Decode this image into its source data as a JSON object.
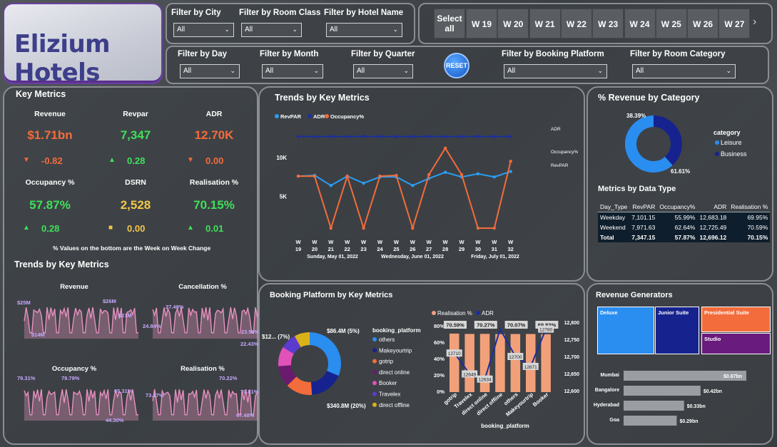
{
  "brand": "Elizium Hotels",
  "filters_top": [
    {
      "label": "Filter by City",
      "value": "All"
    },
    {
      "label": "Filter by Room Class",
      "value": "All"
    },
    {
      "label": "Filter by Hotel Name",
      "value": "All"
    }
  ],
  "filters_bottom": [
    {
      "label": "Filter by Day",
      "value": "All"
    },
    {
      "label": "Filter by Month",
      "value": "All"
    },
    {
      "label": "Filter by Quarter",
      "value": "All"
    },
    {
      "label": "Filter by Booking Platform",
      "value": "All"
    },
    {
      "label": "Filter by Room Category",
      "value": "All"
    }
  ],
  "reset_label": "RESET",
  "week_buttons": {
    "select_all": "Select all",
    "weeks": [
      "W 19",
      "W 20",
      "W 21",
      "W 22",
      "W 23",
      "W 24",
      "W 25",
      "W 26",
      "W 27"
    ]
  },
  "key_metrics": {
    "title": "Key Metrics",
    "items": [
      {
        "label": "Revenue",
        "value": "$1.71bn",
        "change": "-0.82",
        "dir": "down",
        "color": "#f36c3b",
        "chg_color": "#f36c3b"
      },
      {
        "label": "Revpar",
        "value": "7,347",
        "change": "0.28",
        "dir": "up",
        "color": "#3fe05a",
        "chg_color": "#3fe05a"
      },
      {
        "label": "ADR",
        "value": "12.70K",
        "change": "0.00",
        "dir": "down",
        "color": "#f36c3b",
        "chg_color": "#f36c3b"
      },
      {
        "label": "Occupancy %",
        "value": "57.87%",
        "change": "0.28",
        "dir": "up",
        "color": "#3fe05a",
        "chg_color": "#3fe05a"
      },
      {
        "label": "DSRN",
        "value": "2,528",
        "change": "0.00",
        "dir": "flat",
        "color": "#f2c84a",
        "chg_color": "#f2c84a"
      },
      {
        "label": "Realisation %",
        "value": "70.15%",
        "change": "0.01",
        "dir": "up",
        "color": "#3fe05a",
        "chg_color": "#3fe05a"
      }
    ],
    "note": "% Values on the bottom are the Week on Week Change"
  },
  "spark": {
    "title": "Trends by Key Metrics",
    "charts": [
      {
        "title": "Revenue",
        "labels": [
          "$25M",
          "$14M",
          "$26M",
          "$21M"
        ]
      },
      {
        "title": "Cancellation %",
        "labels": [
          "27.48%",
          "24.84%",
          "23.59%",
          "22.43%"
        ]
      },
      {
        "title": "Occupancy %",
        "labels": [
          "79.31%",
          "79.79%",
          "65.31%",
          "44.30%"
        ]
      },
      {
        "title": "Realisation %",
        "labels": [
          "73.17%",
          "70.22%",
          "70.81%",
          "67.48%"
        ]
      }
    ]
  },
  "chart_data": [
    {
      "type": "line",
      "title": "Trends by Key Metrics",
      "legend": [
        "RevPAR",
        "ADR",
        "Occupancy%"
      ],
      "x": [
        "W 19",
        "W 20",
        "W 21",
        "W 22",
        "W 23",
        "W 24",
        "W 25",
        "W 26",
        "W 27",
        "W 28",
        "W 29",
        "W 30",
        "W 31",
        "W 32"
      ],
      "date_labels": [
        "Sunday, May 01, 2022",
        "Wednesday, June 01, 2022",
        "Friday, July 01, 2022"
      ],
      "yticks": [
        "10K",
        "5K"
      ],
      "series": [
        {
          "name": "ADR",
          "color": "#1c2f9e",
          "values": [
            12700,
            12680,
            12700,
            12690,
            12710,
            12700,
            12690,
            12700,
            12710,
            12690,
            12700,
            12710,
            12690,
            12700
          ]
        },
        {
          "name": "RevPAR",
          "color": "#2a9df4",
          "values": [
            7600,
            7700,
            6400,
            7600,
            6700,
            7500,
            7500,
            6400,
            7300,
            8100,
            7500,
            7900,
            7500,
            8200
          ]
        },
        {
          "name": "Occupancy%",
          "color": "#f36c3b",
          "values": [
            7600,
            7600,
            -200,
            7600,
            -100,
            7600,
            7700,
            -200,
            7800,
            11200,
            7800,
            -200,
            -200,
            9500
          ]
        }
      ],
      "end_labels": [
        "ADR",
        "Occupancy%",
        "RevPAR"
      ]
    },
    {
      "type": "pie",
      "title": "% Revenue by Category",
      "legend_title": "category",
      "slices": [
        {
          "name": "Leisure",
          "value": 61.61,
          "color": "#2a8df0"
        },
        {
          "name": "Business",
          "value": 38.39,
          "color": "#16238e"
        }
      ],
      "labels": [
        "38.39%",
        "61.61%"
      ]
    },
    {
      "type": "pie",
      "title": "Booking Platform by Key Metrics",
      "legend_title": "booking_platform",
      "slices": [
        {
          "name": "others",
          "value": 340.8,
          "color": "#2a8df0"
        },
        {
          "name": "Makeyourtrip",
          "value": 190,
          "color": "#16238e"
        },
        {
          "name": "gotrip",
          "value": 150,
          "color": "#f36c3b"
        },
        {
          "name": "direct online",
          "value": 120,
          "color": "#6a1b6e"
        },
        {
          "name": "Booker",
          "value": 110,
          "color": "#e052b8"
        },
        {
          "name": "Travelex",
          "value": 90,
          "color": "#5b3ccf"
        },
        {
          "name": "direct offline",
          "value": 86.4,
          "color": "#d9b21a"
        }
      ],
      "labels": [
        "$86.4M (5%)",
        "$12... (7%)",
        "$340.8M (20%)"
      ]
    },
    {
      "type": "bar",
      "legend": [
        "Realisation %",
        "ADR"
      ],
      "categories": [
        "gotrip",
        "Travelex",
        "direct online",
        "direct offline",
        "others",
        "Makeyourtrip",
        "Booker"
      ],
      "values": [
        70.59,
        70.2,
        70.27,
        70.0,
        70.07,
        70.1,
        69.83
      ],
      "value_labels": [
        "70.59%",
        "",
        "70.27%",
        "",
        "70.07%",
        "",
        "69.83%"
      ],
      "adr": [
        12710,
        12649,
        12634,
        12780,
        12700,
        12671,
        12780
      ],
      "adr_labels": [
        "12710",
        "12649",
        "12634",
        "",
        "12700",
        "12671",
        "12780"
      ],
      "yticks_left": [
        "80%",
        "60%",
        "40%",
        "20%",
        "0%"
      ],
      "yticks_right": [
        "12,800",
        "12,750",
        "12,700",
        "12,650",
        "12,600"
      ],
      "xlabel": "booking_platform"
    },
    {
      "type": "treemap",
      "title": "Revenue Generators",
      "items": [
        {
          "name": "Deluxe",
          "color": "#2a8df0"
        },
        {
          "name": "Junior Suite",
          "color": "#16238e"
        },
        {
          "name": "Presidential Suite",
          "color": "#f36c3b"
        },
        {
          "name": "Studio",
          "color": "#6a1b7e"
        }
      ]
    },
    {
      "type": "bar",
      "orientation": "horizontal",
      "categories": [
        "Mumbai",
        "Bangalore",
        "Hyderabad",
        "Goa"
      ],
      "values": [
        0.67,
        0.42,
        0.33,
        0.29
      ],
      "labels": [
        "$0.67bn",
        "$0.42bn",
        "$0.33bn",
        "$0.29bn"
      ]
    }
  ],
  "metrics_table": {
    "title": "Metrics by Data Type",
    "headers": [
      "Day_Type",
      "RevPAR",
      "Occupancy%",
      "ADR",
      "Realisation %"
    ],
    "rows": [
      [
        "Weekday",
        "7,101.15",
        "55.99%",
        "12,683.18",
        "69.95%"
      ],
      [
        "Weekend",
        "7,971.63",
        "62.64%",
        "12,725.49",
        "70.59%"
      ]
    ],
    "total": [
      "Total",
      "7,347.15",
      "57.87%",
      "12,696.12",
      "70.15%"
    ]
  },
  "titles": {
    "trends": "Trends by Key Metrics",
    "category": "% Revenue by Category",
    "booking": "Booking Platform by Key Metrics",
    "revenue_gen": "Revenue Generators"
  }
}
